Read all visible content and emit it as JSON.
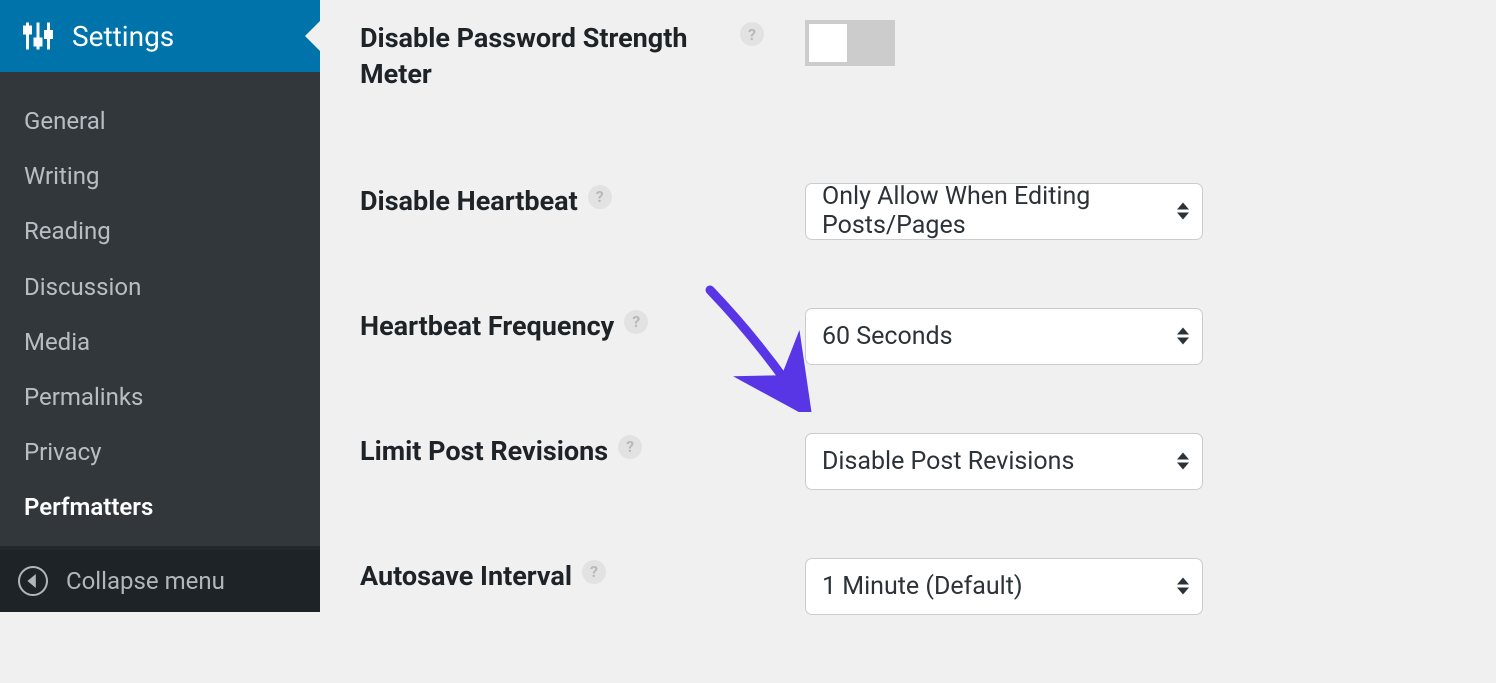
{
  "sidebar": {
    "active_label": "Settings",
    "items": [
      {
        "label": "General",
        "current": false
      },
      {
        "label": "Writing",
        "current": false
      },
      {
        "label": "Reading",
        "current": false
      },
      {
        "label": "Discussion",
        "current": false
      },
      {
        "label": "Media",
        "current": false
      },
      {
        "label": "Permalinks",
        "current": false
      },
      {
        "label": "Privacy",
        "current": false
      },
      {
        "label": "Perfmatters",
        "current": true
      }
    ],
    "collapse_label": "Collapse menu"
  },
  "settings": {
    "disable_password_strength": {
      "label": "Disable Password Strength Meter",
      "value": false
    },
    "disable_heartbeat": {
      "label": "Disable Heartbeat",
      "value": "Only Allow When Editing Posts/Pages"
    },
    "heartbeat_frequency": {
      "label": "Heartbeat Frequency",
      "value": "60 Seconds"
    },
    "limit_post_revisions": {
      "label": "Limit Post Revisions",
      "value": "Disable Post Revisions"
    },
    "autosave_interval": {
      "label": "Autosave Interval",
      "value": "1 Minute (Default)"
    }
  },
  "help_glyph": "?",
  "annotation": {
    "arrow_color": "#5835e5"
  }
}
